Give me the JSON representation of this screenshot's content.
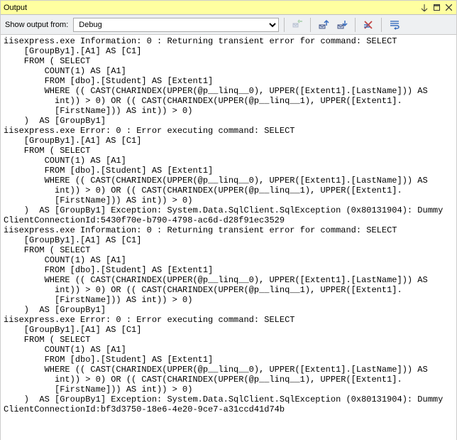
{
  "window": {
    "title": "Output"
  },
  "toolbar": {
    "label": "Show output from:",
    "selected": "Debug"
  },
  "content": "iisexpress.exe Information: 0 : Returning transient error for command: SELECT \n    [GroupBy1].[A1] AS [C1]\n    FROM ( SELECT \n        COUNT(1) AS [A1]\n        FROM [dbo].[Student] AS [Extent1]\n        WHERE (( CAST(CHARINDEX(UPPER(@p__linq__0), UPPER([Extent1].[LastName])) AS \n          int)) > 0) OR (( CAST(CHARINDEX(UPPER(@p__linq__1), UPPER([Extent1].\n          [FirstName])) AS int)) > 0)\n    )  AS [GroupBy1]\niisexpress.exe Error: 0 : Error executing command: SELECT \n    [GroupBy1].[A1] AS [C1]\n    FROM ( SELECT \n        COUNT(1) AS [A1]\n        FROM [dbo].[Student] AS [Extent1]\n        WHERE (( CAST(CHARINDEX(UPPER(@p__linq__0), UPPER([Extent1].[LastName])) AS \n          int)) > 0) OR (( CAST(CHARINDEX(UPPER(@p__linq__1), UPPER([Extent1].\n          [FirstName])) AS int)) > 0)\n    )  AS [GroupBy1] Exception: System.Data.SqlClient.SqlException (0x80131904): Dummy\nClientConnectionId:5430f70e-b790-4798-ac6d-d28f91ec3529\niisexpress.exe Information: 0 : Returning transient error for command: SELECT \n    [GroupBy1].[A1] AS [C1]\n    FROM ( SELECT \n        COUNT(1) AS [A1]\n        FROM [dbo].[Student] AS [Extent1]\n        WHERE (( CAST(CHARINDEX(UPPER(@p__linq__0), UPPER([Extent1].[LastName])) AS \n          int)) > 0) OR (( CAST(CHARINDEX(UPPER(@p__linq__1), UPPER([Extent1].\n          [FirstName])) AS int)) > 0)\n    )  AS [GroupBy1]\niisexpress.exe Error: 0 : Error executing command: SELECT \n    [GroupBy1].[A1] AS [C1]\n    FROM ( SELECT \n        COUNT(1) AS [A1]\n        FROM [dbo].[Student] AS [Extent1]\n        WHERE (( CAST(CHARINDEX(UPPER(@p__linq__0), UPPER([Extent1].[LastName])) AS \n          int)) > 0) OR (( CAST(CHARINDEX(UPPER(@p__linq__1), UPPER([Extent1].\n          [FirstName])) AS int)) > 0)\n    )  AS [GroupBy1] Exception: System.Data.SqlClient.SqlException (0x80131904): Dummy\nClientConnectionId:bf3d3750-18e6-4e20-9ce7-a31ccd41d74b"
}
